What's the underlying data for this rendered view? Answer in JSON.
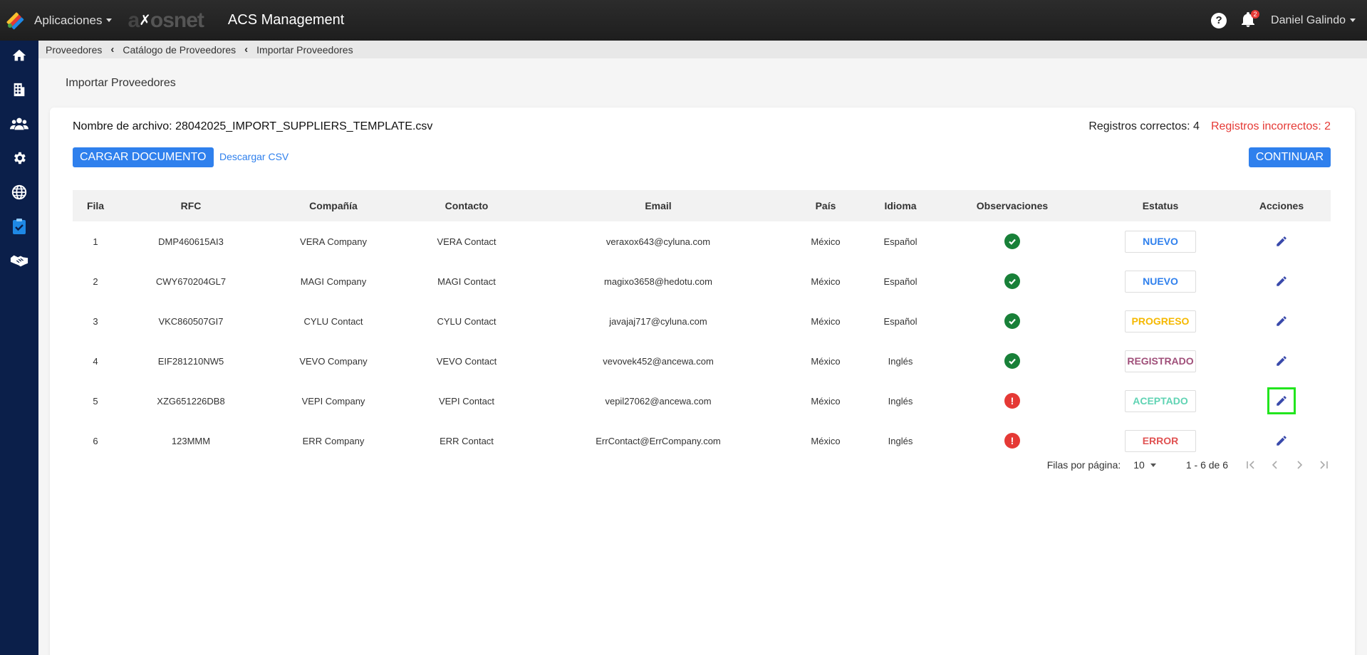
{
  "header": {
    "apps_label": "Aplicaciones",
    "brand_prefix": "a",
    "brand_suffix": "osnet",
    "app_title": "ACS Management",
    "notification_count": "2",
    "user_name": "Daniel Galindo"
  },
  "breadcrumb": {
    "items": [
      "Proveedores",
      "Catálogo de Proveedores",
      "Importar Proveedores"
    ]
  },
  "page": {
    "title": "Importar Proveedores",
    "file_name": "Nombre de archivo: 28042025_IMPORT_SUPPLIERS_TEMPLATE.csv",
    "correct_records": "Registros correctos: 4",
    "incorrect_records": "Registros incorrectos: 2",
    "upload_button": "CARGAR DOCUMENTO",
    "download_link": "Descargar CSV",
    "continue_button": "CONTINUAR"
  },
  "table": {
    "headers": [
      "Fila",
      "RFC",
      "Compañía",
      "Contacto",
      "Email",
      "País",
      "Idioma",
      "Observaciones",
      "Estatus",
      "Acciones"
    ],
    "rows": [
      {
        "fila": "1",
        "rfc": "DMP460615AI3",
        "company": "VERA Company",
        "contact": "VERA Contact",
        "email": "veraxox643@cyluna.com",
        "country": "México",
        "language": "Español",
        "observation": "ok",
        "status": "NUEVO",
        "status_color": "#2f80ed"
      },
      {
        "fila": "2",
        "rfc": "CWY670204GL7",
        "company": "MAGI Company",
        "contact": "MAGI Contact",
        "email": "magixo3658@hedotu.com",
        "country": "México",
        "language": "Español",
        "observation": "ok",
        "status": "NUEVO",
        "status_color": "#2f80ed"
      },
      {
        "fila": "3",
        "rfc": "VKC860507GI7",
        "company": "CYLU Contact",
        "contact": "CYLU Contact",
        "email": "javajaj717@cyluna.com",
        "country": "México",
        "language": "Español",
        "observation": "ok",
        "status": "PROGRESO",
        "status_color": "#f5b800"
      },
      {
        "fila": "4",
        "rfc": "EIF281210NW5",
        "company": "VEVO Company",
        "contact": "VEVO Contact",
        "email": "vevovek452@ancewa.com",
        "country": "México",
        "language": "Inglés",
        "observation": "ok",
        "status": "REGISTRADO",
        "status_color": "#a0507a"
      },
      {
        "fila": "5",
        "rfc": "XZG651226DB8",
        "company": "VEPI Company",
        "contact": "VEPI Contact",
        "email": "vepil27062@ancewa.com",
        "country": "México",
        "language": "Inglés",
        "observation": "error",
        "status": "ACEPTADO",
        "status_color": "#5fd3b3"
      },
      {
        "fila": "6",
        "rfc": "123MMM",
        "company": "ERR Company",
        "contact": "ERR Contact",
        "email": "ErrContact@ErrCompany.com",
        "country": "México",
        "language": "Inglés",
        "observation": "error",
        "status": "ERROR",
        "status_color": "#e05252"
      }
    ],
    "focused_edit_row": 4
  },
  "pagination": {
    "rows_per_page_label": "Filas por página:",
    "rows_per_page": "10",
    "range": "1 - 6 de 6"
  },
  "sidebar": {
    "icons": [
      "home-icon",
      "building-icon",
      "users-icon",
      "gear-icon",
      "globe-icon",
      "clipboard-check-icon",
      "handshake-icon"
    ]
  },
  "colors": {
    "topbar": "#232323",
    "sidebar": "#0b1f4a",
    "primary": "#2f80ed",
    "error": "#e53935",
    "success": "#188038",
    "edit_icon": "#3949ab",
    "focus_outline": "#22e51e"
  }
}
